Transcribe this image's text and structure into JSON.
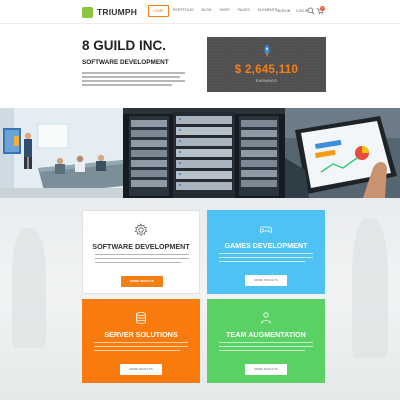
{
  "brand": {
    "name": "TRIUMPH",
    "accent": "#f57f17",
    "logo_color": "#8cc63e"
  },
  "nav": {
    "items": [
      {
        "label": "HOME",
        "active": true
      },
      {
        "label": "PORTFOLIO",
        "active": false
      },
      {
        "label": "BLOG",
        "active": false
      },
      {
        "label": "SHOP",
        "active": false
      },
      {
        "label": "PAGES",
        "active": false
      },
      {
        "label": "ELEMENTS",
        "active": false
      }
    ],
    "sign_in": "SIGN IN",
    "log_in": "LOG IN",
    "search_icon": "search-icon",
    "cart_icon": "cart-icon",
    "cart_count": "0"
  },
  "intro": {
    "company": "8 GUILD INC.",
    "tagline": "SOFTWARE DEVELOPMENT",
    "stat": {
      "value": "$ 2,645,110",
      "label": "EARNINGS",
      "icon": "rocket-icon"
    }
  },
  "photos": [
    {
      "name": "office-presentation-photo"
    },
    {
      "name": "server-rack-photo"
    },
    {
      "name": "tablet-analytics-photo"
    }
  ],
  "services": [
    {
      "title": "SOFTWARE DEVELOPMENT",
      "icon": "gear-icon",
      "button": "MORE RESULTS",
      "color": "#ffffff"
    },
    {
      "title": "GAMES DEVELOPMENT",
      "icon": "gamepad-icon",
      "button": "MORE RESULTS",
      "color": "#4fc2f4"
    },
    {
      "title": "SERVER SOLUTIONS",
      "icon": "database-icon",
      "button": "MORE RESULTS",
      "color": "#f97b0e"
    },
    {
      "title": "TEAM AUGMENTATION",
      "icon": "team-icon",
      "button": "MORE RESULTS",
      "color": "#59d164"
    }
  ]
}
